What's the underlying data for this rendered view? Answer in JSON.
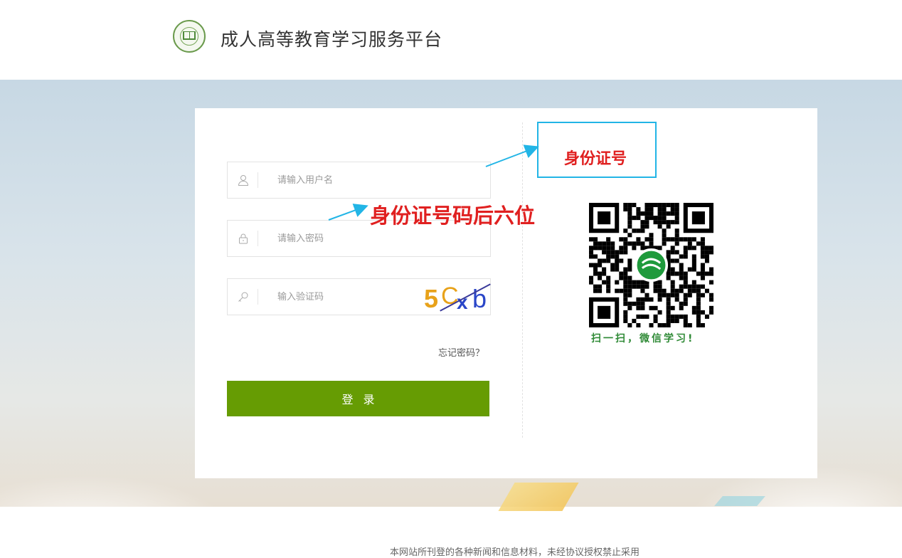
{
  "header": {
    "site_title": "成人高等教育学习服务平台",
    "logo_icon": "school-seal-logo"
  },
  "login": {
    "username_placeholder": "请输入用户名",
    "password_placeholder": "请输入密码",
    "captcha_placeholder": "输入验证码",
    "captcha_chars": [
      "5",
      "C",
      "x",
      "b"
    ],
    "captcha_colors": [
      "#e8a21a",
      "#e8a21a",
      "#2a46c8",
      "#2a46c8"
    ],
    "forgot_label": "忘记密码？",
    "login_label": "登录",
    "button_color": "#669c03",
    "icons": [
      "user-icon",
      "lock-icon",
      "key-icon"
    ]
  },
  "annotations": {
    "box_label": "身份证号",
    "password_hint": "身份证号码后六位",
    "text_color": "#e02020",
    "arrow_color": "#22b5e6"
  },
  "qr": {
    "caption": "扫一扫，微信学习!",
    "center_icon": "wechat-swirl-logo"
  },
  "footer": {
    "text": "本网站所刊登的各种新闻和信息材料，未经协议授权禁止采用"
  }
}
